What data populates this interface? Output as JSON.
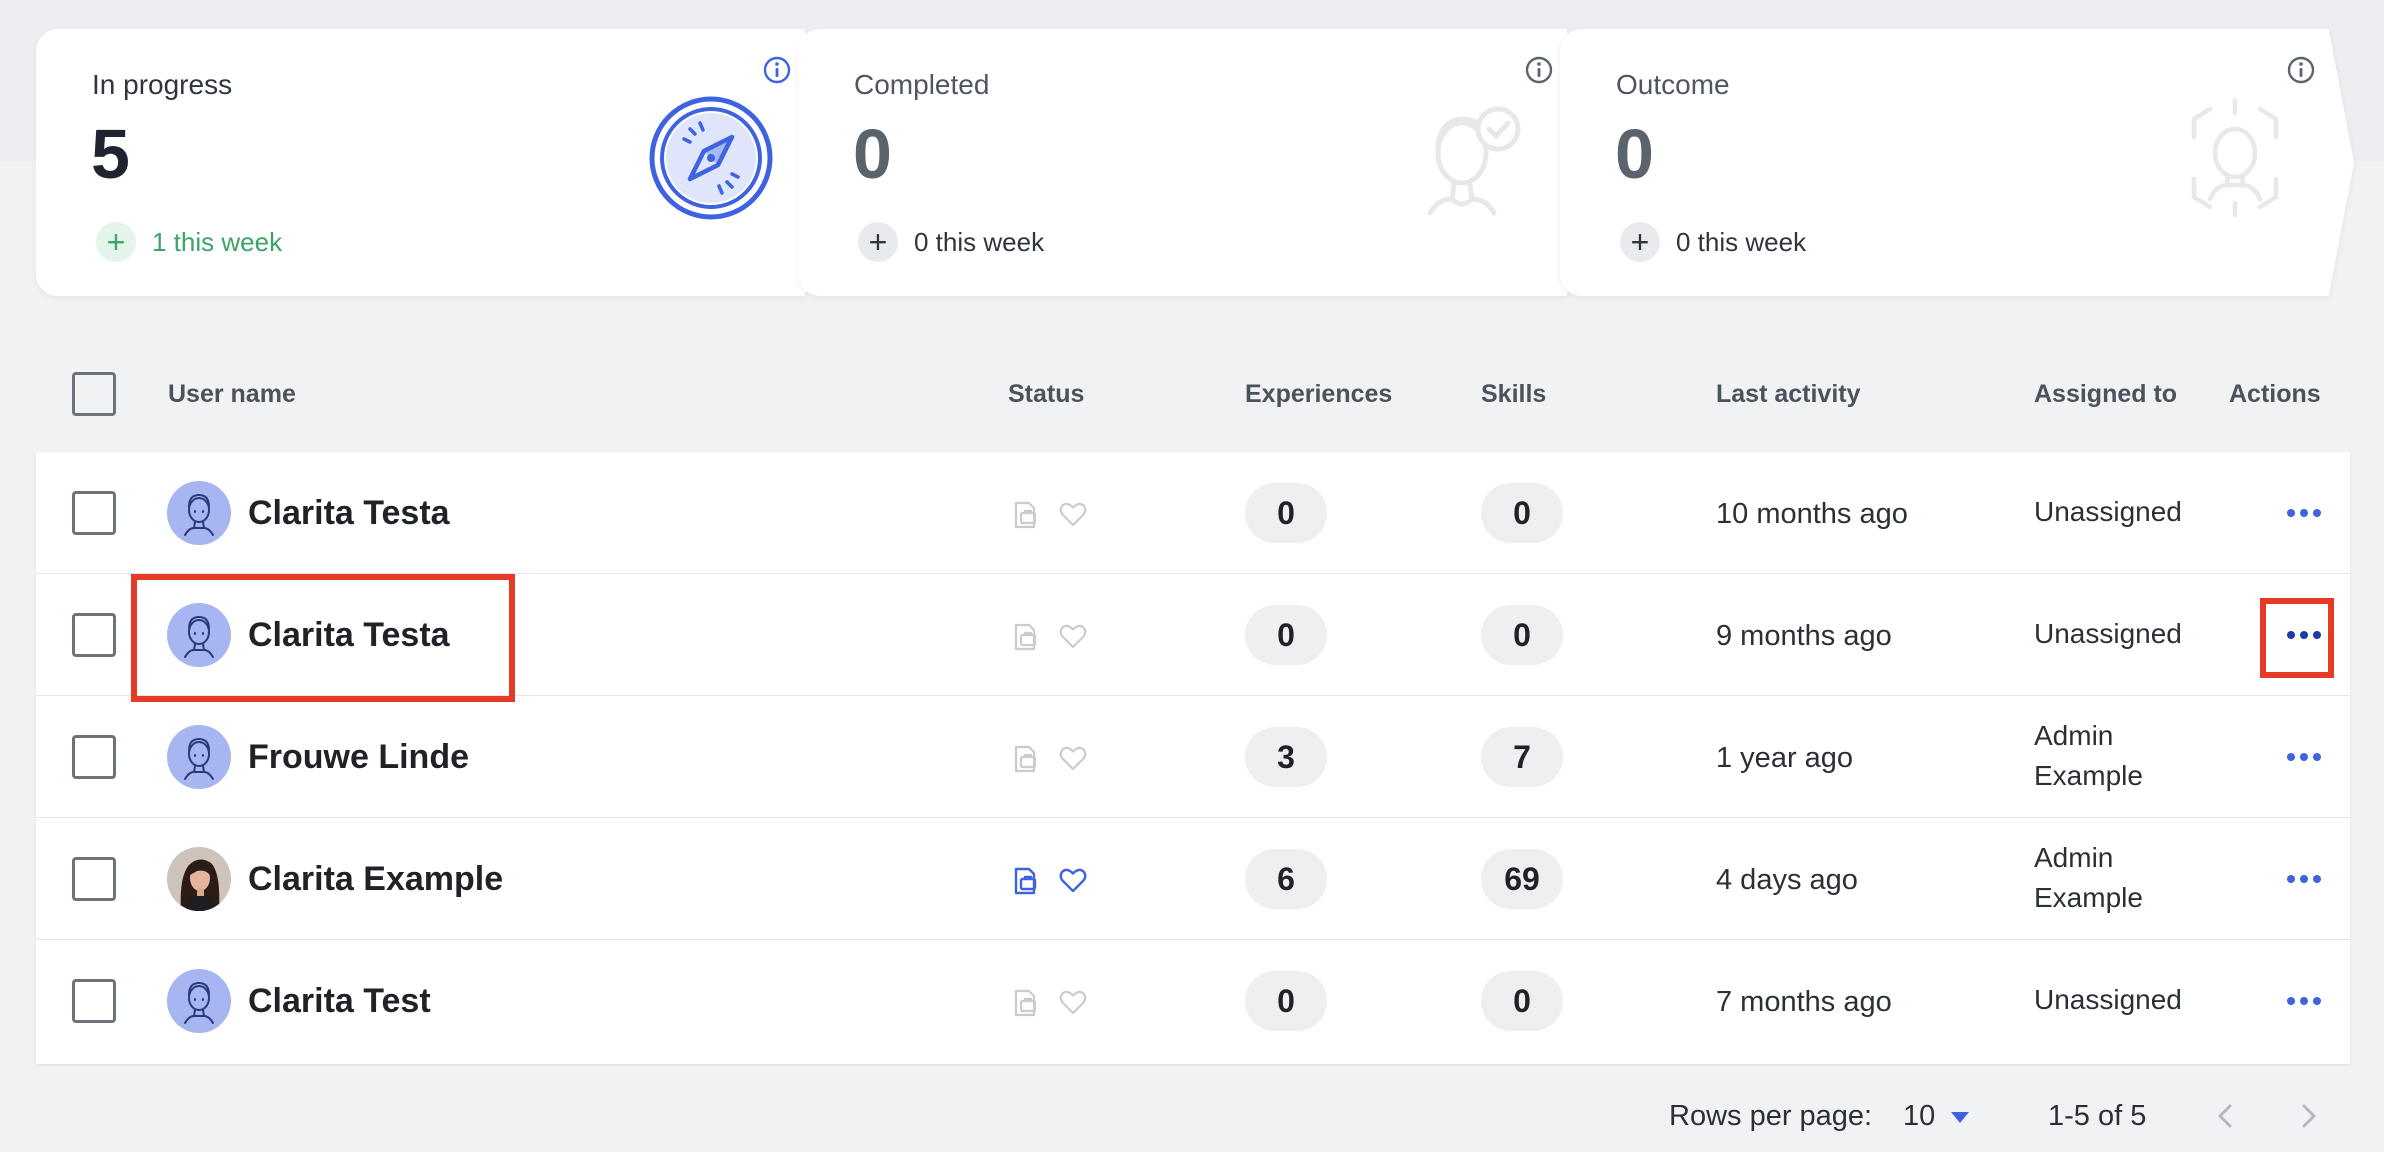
{
  "cards": [
    {
      "title": "In progress",
      "value": "5",
      "week": "1 this week",
      "art_icon": "compass-icon"
    },
    {
      "title": "Completed",
      "value": "0",
      "week": "0 this week",
      "art_icon": "user-check-icon"
    },
    {
      "title": "Outcome",
      "value": "0",
      "week": "0 this week",
      "art_icon": "user-focus-icon"
    }
  ],
  "table": {
    "headers": {
      "user_name": "User name",
      "status": "Status",
      "experiences": "Experiences",
      "skills": "Skills",
      "last_activity": "Last activity",
      "assigned_to": "Assigned to",
      "actions": "Actions"
    },
    "rows": [
      {
        "name": "Clarita Testa",
        "experiences": "0",
        "skills": "0",
        "last_activity": "10 months ago",
        "assigned_line1": "Unassigned",
        "assigned_line2": "",
        "status_active": false,
        "avatar": "default-avatar-icon"
      },
      {
        "name": "Clarita Testa",
        "experiences": "0",
        "skills": "0",
        "last_activity": "9 months ago",
        "assigned_line1": "Unassigned",
        "assigned_line2": "",
        "status_active": false,
        "avatar": "default-avatar-icon"
      },
      {
        "name": "Frouwe Linde",
        "experiences": "3",
        "skills": "7",
        "last_activity": "1 year ago",
        "assigned_line1": "Admin",
        "assigned_line2": "Example",
        "status_active": false,
        "avatar": "default-avatar-icon"
      },
      {
        "name": "Clarita Example",
        "experiences": "6",
        "skills": "69",
        "last_activity": "4 days ago",
        "assigned_line1": "Admin",
        "assigned_line2": "Example",
        "status_active": true,
        "avatar": "photo-avatar"
      },
      {
        "name": "Clarita Test",
        "experiences": "0",
        "skills": "0",
        "last_activity": "7 months ago",
        "assigned_line1": "Unassigned",
        "assigned_line2": "",
        "status_active": false,
        "avatar": "default-avatar-icon"
      }
    ]
  },
  "pagination": {
    "rows_per_page_label": "Rows per page:",
    "rows_per_page_value": "10",
    "range": "1-5 of 5"
  },
  "colors": {
    "accent": "#3f63e0",
    "success": "#3aa564",
    "highlight": "#e53a25"
  }
}
